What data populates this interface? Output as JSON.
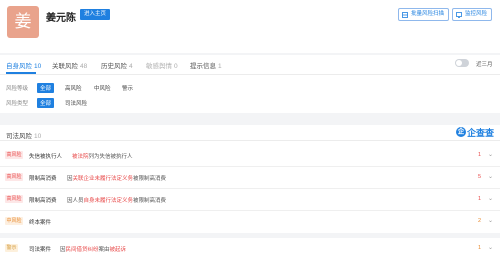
{
  "header": {
    "avatar_char": "姜",
    "company_name": "姜元陈",
    "enter_button": "进入主页",
    "batch_scan_button": "批量风险扫描",
    "monitor_button": "监控风险"
  },
  "tabs": [
    {
      "label": "自身风险",
      "count": "10"
    },
    {
      "label": "关联风险",
      "count": "48"
    },
    {
      "label": "历史风险",
      "count": "4"
    },
    {
      "label": "敏感舆情",
      "count": "0"
    },
    {
      "label": "提示信息",
      "count": "1"
    }
  ],
  "toggle_label": "近三月",
  "filters": {
    "level_label": "风险等级",
    "level_options": [
      "全部",
      "高风险",
      "中风险",
      "警示"
    ],
    "type_label": "风险类型",
    "type_options": [
      "全部",
      "司法风险"
    ]
  },
  "section": {
    "title": "司法风险",
    "count": "10",
    "logo_char": "企",
    "logo_text": "企查查"
  },
  "rows": [
    {
      "badge": "高风险",
      "type": "失信被执行人",
      "desc_pre": "",
      "desc_hl": "被法院",
      "desc_post": "列为失信被执行人",
      "count": "1"
    },
    {
      "badge": "高风险",
      "type": "限制高消费",
      "desc_pre": "因",
      "desc_hl": "关联企业未履行法定义务",
      "desc_post": "被限制高消费",
      "count": "5"
    },
    {
      "badge": "高风险",
      "type": "限制高消费",
      "desc_pre": "因人员",
      "desc_hl": "自身未履行法定义务",
      "desc_post": "被限制高消费",
      "count": "1"
    },
    {
      "badge": "中风险",
      "type": "终本案件",
      "desc_pre": "",
      "desc_hl": "",
      "desc_post": "",
      "count": "2"
    },
    {
      "badge": "警示",
      "type": "司法案件",
      "desc_pre": "因",
      "desc_hl": "民间借贷纠纷",
      "desc_post": "案由",
      "desc_hl2": "被起诉",
      "count": "1"
    }
  ],
  "colors": {
    "accent": "#1f80e0",
    "high": "#e84a4a",
    "mid": "#e8892d"
  }
}
